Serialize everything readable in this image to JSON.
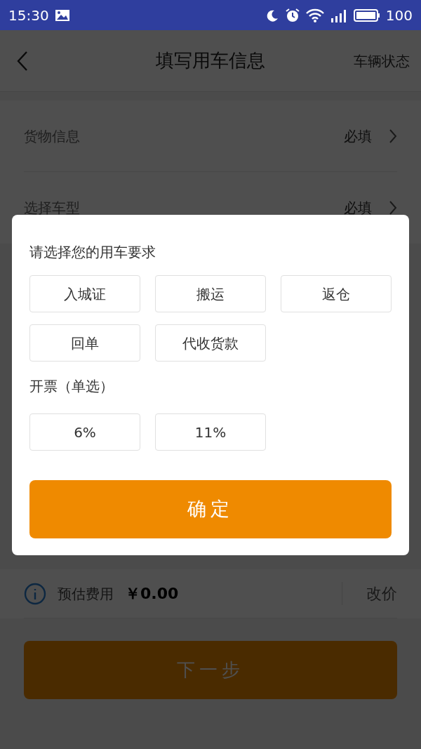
{
  "status_bar": {
    "time": "15:30",
    "battery": "100"
  },
  "header": {
    "title": "填写用车信息",
    "action": "车辆状态"
  },
  "form_rows": [
    {
      "label": "货物信息",
      "value": "必填"
    },
    {
      "label": "选择车型",
      "value": "必填"
    }
  ],
  "price_bar": {
    "label": "预估费用",
    "amount": "￥0.00",
    "action": "改价"
  },
  "next_button": "下一步",
  "dialog": {
    "title": "请选择您的用车要求",
    "options": [
      {
        "label": "入城证",
        "selected": false
      },
      {
        "label": "搬运",
        "selected": false
      },
      {
        "label": "返仓",
        "selected": false
      },
      {
        "label": "回单",
        "selected": false
      },
      {
        "label": "代收货款",
        "selected": false
      }
    ],
    "invoice_title": "开票（单选）",
    "invoice_options": [
      {
        "label": "6%",
        "selected": false
      },
      {
        "label": "11%",
        "selected": false
      }
    ],
    "confirm": "确定"
  }
}
